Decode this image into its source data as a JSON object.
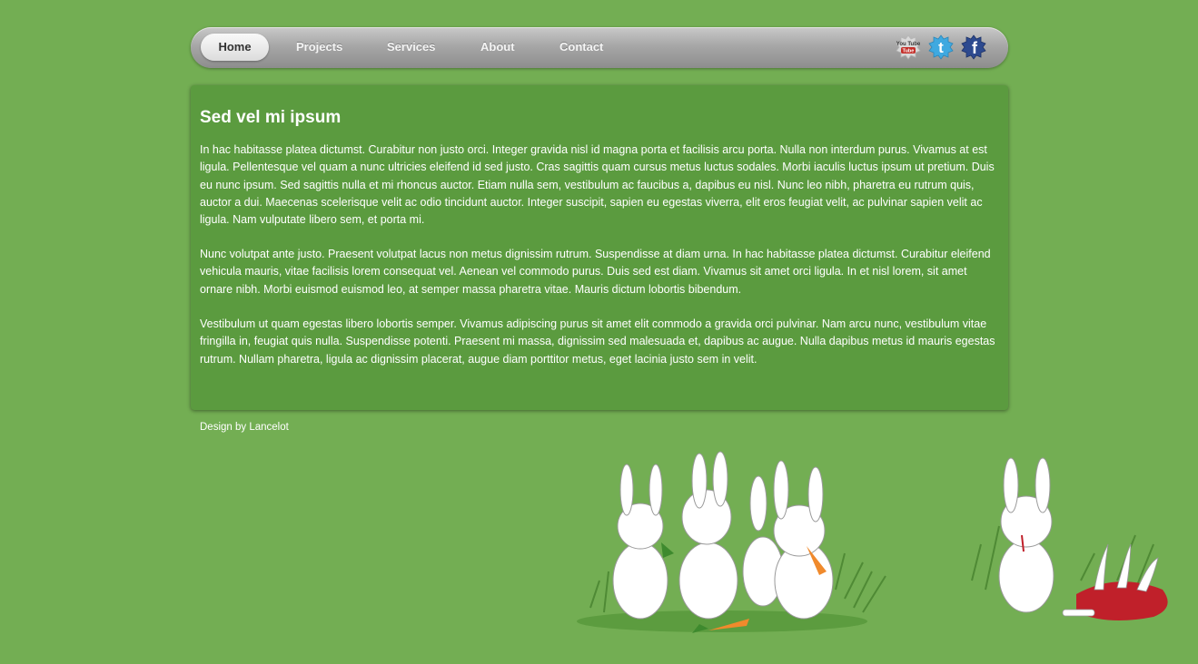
{
  "nav": {
    "items": [
      {
        "label": "Home",
        "active": true
      },
      {
        "label": "Projects"
      },
      {
        "label": "Services"
      },
      {
        "label": "About"
      },
      {
        "label": "Contact"
      }
    ],
    "social": [
      {
        "icon": "youtube-icon",
        "text": "You Tube"
      },
      {
        "icon": "twitter-icon",
        "text": "t"
      },
      {
        "icon": "facebook-icon",
        "text": "f"
      }
    ]
  },
  "main": {
    "title": "Sed vel mi ipsum",
    "paragraphs": [
      "In hac habitasse platea dictumst. Curabitur non justo orci. Integer gravida nisl id magna porta et facilisis arcu porta. Nulla non interdum purus. Vivamus at est ligula. Pellentesque vel quam a nunc ultricies eleifend id sed justo. Cras sagittis quam cursus metus luctus sodales. Morbi iaculis luctus ipsum ut pretium. Duis eu nunc ipsum. Sed sagittis nulla et mi rhoncus auctor. Etiam nulla sem, vestibulum ac faucibus a, dapibus eu nisl. Nunc leo nibh, pharetra eu rutrum quis, auctor a dui. Maecenas scelerisque velit ac odio tincidunt auctor. Integer suscipit, sapien eu egestas viverra, elit eros feugiat velit, ac pulvinar sapien velit ac ligula. Nam vulputate libero sem, et porta mi.",
      "Nunc volutpat ante justo. Praesent volutpat lacus non metus dignissim rutrum. Suspendisse at diam urna. In hac habitasse platea dictumst. Curabitur eleifend vehicula mauris, vitae facilisis lorem consequat vel. Aenean vel commodo purus. Duis sed est diam. Vivamus sit amet orci ligula. In et nisl lorem, sit amet ornare nibh. Morbi euismod euismod leo, at semper massa pharetra vitae. Mauris dictum lobortis bibendum.",
      "Vestibulum ut quam egestas libero lobortis semper. Vivamus adipiscing purus sit amet elit commodo a gravida orci pulvinar. Nam arcu nunc, vestibulum vitae fringilla in, feugiat quis nulla. Suspendisse potenti. Praesent mi massa, dignissim sed malesuada et, dapibus ac augue. Nulla dapibus metus id mauris egestas rutrum. Nullam pharetra, ligula ac dignissim placerat, augue diam porttitor metus, eget lacinia justo sem in velit."
    ]
  },
  "footer": {
    "credit": "Design by Lancelot"
  },
  "colors": {
    "background": "#73ae53",
    "panel": "#5b9b3f"
  }
}
